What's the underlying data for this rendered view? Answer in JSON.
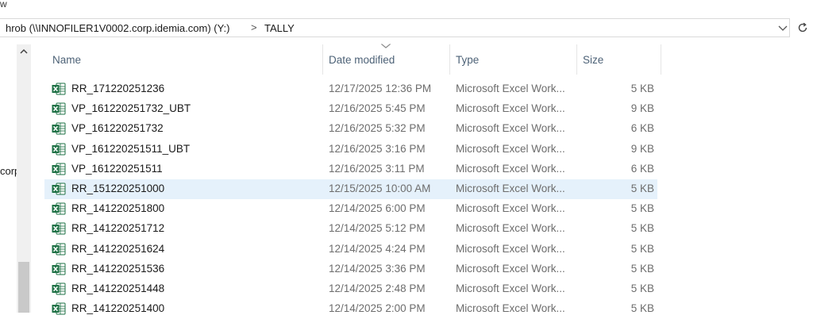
{
  "top_fragment": "w",
  "address": {
    "path_text": "hrob (\\\\INNOFILER1V0002.corp.idemia.com) (Y:)",
    "separator": ">",
    "current_folder": "TALLY",
    "dropdown_icon": "chevron-down-icon",
    "refresh_icon": "refresh-icon"
  },
  "nav": {
    "fragment": "corp",
    "scroll_up_icon": "chevron-up-icon"
  },
  "columns": {
    "name": "Name",
    "date": "Date modified",
    "type": "Type",
    "size": "Size",
    "sorted_column": "date",
    "sort_icon": "sort-caret-down-icon"
  },
  "files": [
    {
      "name": "RR_171220251236",
      "date": "12/17/2025 12:36 PM",
      "type": "Microsoft Excel Work...",
      "size": "5 KB",
      "selected": false
    },
    {
      "name": "VP_161220251732_UBT",
      "date": "12/16/2025 5:45 PM",
      "type": "Microsoft Excel Work...",
      "size": "9 KB",
      "selected": false
    },
    {
      "name": "VP_161220251732",
      "date": "12/16/2025 5:32 PM",
      "type": "Microsoft Excel Work...",
      "size": "6 KB",
      "selected": false
    },
    {
      "name": "VP_161220251511_UBT",
      "date": "12/16/2025 3:16 PM",
      "type": "Microsoft Excel Work...",
      "size": "9 KB",
      "selected": false
    },
    {
      "name": "VP_161220251511",
      "date": "12/16/2025 3:11 PM",
      "type": "Microsoft Excel Work...",
      "size": "6 KB",
      "selected": false
    },
    {
      "name": "RR_151220251000",
      "date": "12/15/2025 10:00 AM",
      "type": "Microsoft Excel Work...",
      "size": "5 KB",
      "selected": true
    },
    {
      "name": "RR_141220251800",
      "date": "12/14/2025 6:00 PM",
      "type": "Microsoft Excel Work...",
      "size": "5 KB",
      "selected": false
    },
    {
      "name": "RR_141220251712",
      "date": "12/14/2025 5:12 PM",
      "type": "Microsoft Excel Work...",
      "size": "5 KB",
      "selected": false
    },
    {
      "name": "RR_141220251624",
      "date": "12/14/2025 4:24 PM",
      "type": "Microsoft Excel Work...",
      "size": "5 KB",
      "selected": false
    },
    {
      "name": "RR_141220251536",
      "date": "12/14/2025 3:36 PM",
      "type": "Microsoft Excel Work...",
      "size": "5 KB",
      "selected": false
    },
    {
      "name": "RR_141220251448",
      "date": "12/14/2025 2:48 PM",
      "type": "Microsoft Excel Work...",
      "size": "5 KB",
      "selected": false
    },
    {
      "name": "RR_141220251400",
      "date": "12/14/2025 2:00 PM",
      "type": "Microsoft Excel Work...",
      "size": "5 KB",
      "selected": false
    }
  ],
  "file_icon": "excel-file-icon",
  "colors": {
    "selected_row": "#e5f1fb",
    "header_text": "#4d6277",
    "excel_green": "#1e7145"
  }
}
